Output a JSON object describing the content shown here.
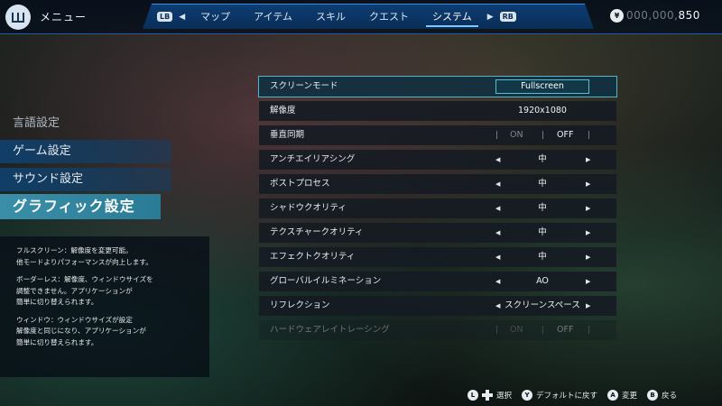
{
  "header": {
    "menu_title": "メニュー",
    "lb": "LB",
    "rb": "RB",
    "tabs": [
      "マップ",
      "アイテム",
      "スキル",
      "クエスト",
      "システム"
    ],
    "active_tab": "システム",
    "money_dim": "000,000,",
    "money_bright": "850",
    "coin_symbol": "¥"
  },
  "sidebar": {
    "items": [
      "言語設定",
      "ゲーム設定",
      "サウンド設定",
      "グラフィック設定"
    ],
    "selected": "グラフィック設定"
  },
  "description": {
    "paragraphs": [
      "フルスクリーン：解像度を変更可能。\n他モードよりパフォーマンスが向上します。",
      "ボーダーレス：解像度、ウィンドウサイズを\n調整できません。アプリケーションが\n簡単に切り替えられます。",
      "ウィンドウ：ウィンドウサイズが設定\n解像度と同じになり、アプリケーションが\n簡単に切り替えられます。"
    ]
  },
  "settings": [
    {
      "label": "スクリーンモード",
      "value": "Fullscreen"
    },
    {
      "label": "解像度",
      "value": "1920x1080"
    },
    {
      "label": "垂直同期",
      "on": "ON",
      "off": "OFF"
    },
    {
      "label": "アンチエイリアシング",
      "value": "中"
    },
    {
      "label": "ポストプロセス",
      "value": "中"
    },
    {
      "label": "シャドウクオリティ",
      "value": "中"
    },
    {
      "label": "テクスチャークオリティ",
      "value": "中"
    },
    {
      "label": "エフェクトクオリティ",
      "value": "中"
    },
    {
      "label": "グローバルイルミネーション",
      "value": "AO"
    },
    {
      "label": "リフレクション",
      "value": "スクリーンスペース"
    },
    {
      "label": "ハードウェアレイトレーシング",
      "on": "ON",
      "off": "OFF"
    }
  ],
  "hints": {
    "l_label": "L",
    "select": "選択",
    "y_btn": "Y",
    "default": "デフォルトに戻す",
    "a_btn": "A",
    "change": "変更",
    "b_btn": "B",
    "back": "戻る"
  },
  "colors": {
    "accent": "#4fb7c9",
    "tab_bar": "#0d3d73",
    "selected_category": "#3a8fa8"
  }
}
